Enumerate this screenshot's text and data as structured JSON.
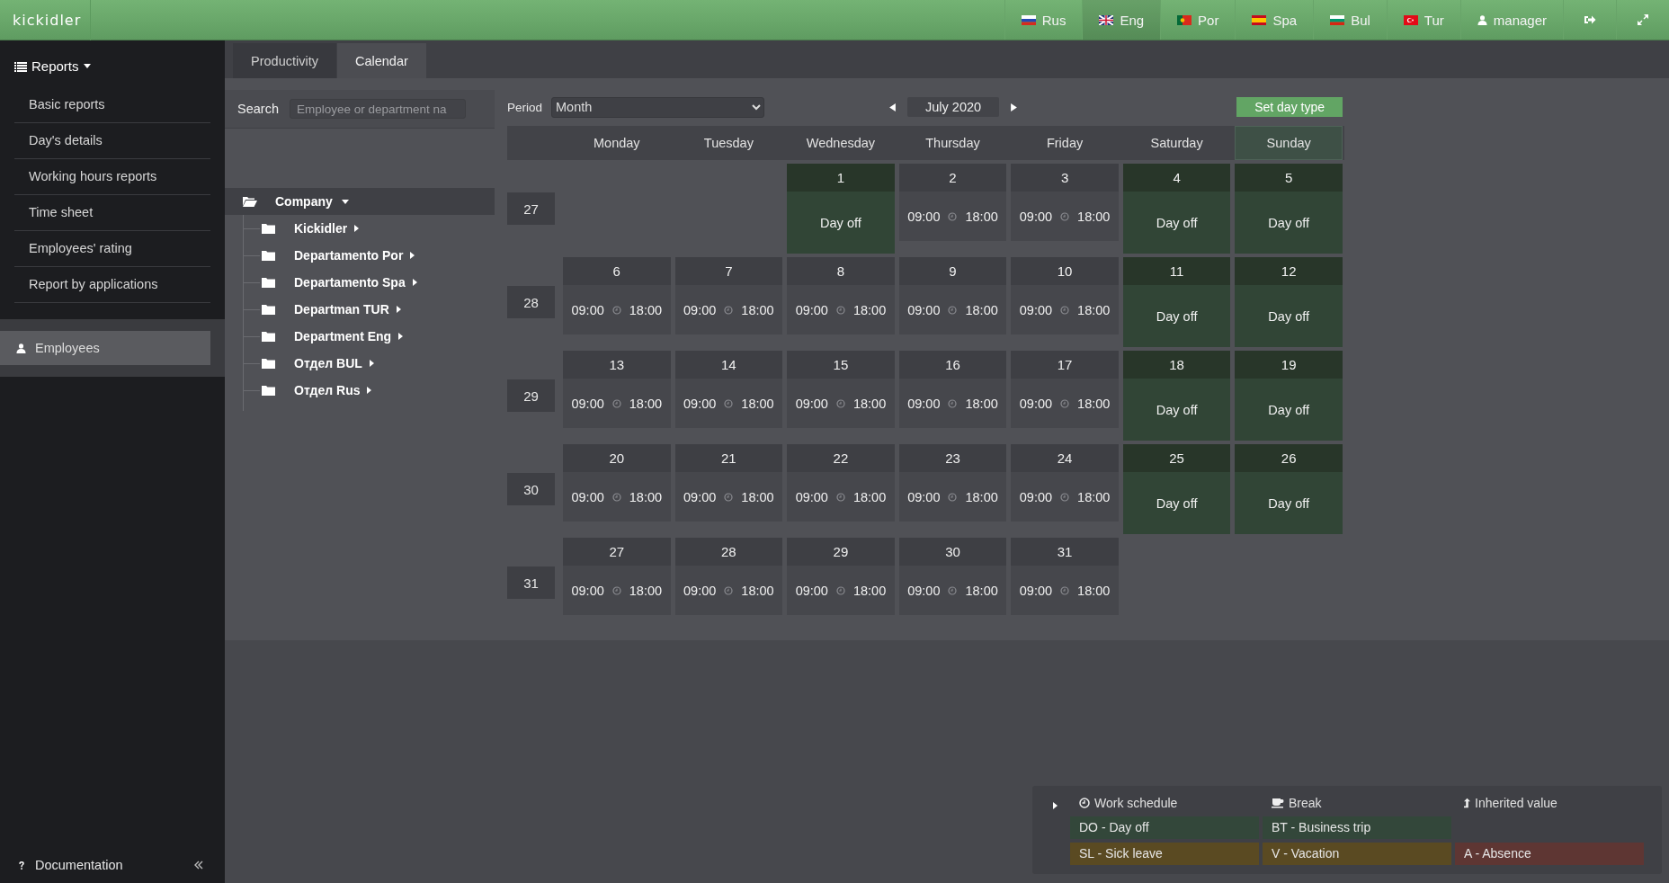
{
  "topbar": {
    "logo": "kickidler",
    "languages": [
      {
        "label": "Rus",
        "selected": false
      },
      {
        "label": "Eng",
        "selected": true
      },
      {
        "label": "Por",
        "selected": false
      },
      {
        "label": "Spa",
        "selected": false
      },
      {
        "label": "Bul",
        "selected": false
      },
      {
        "label": "Tur",
        "selected": false
      }
    ],
    "user": "manager"
  },
  "sidebar": {
    "section": "Reports",
    "items": [
      {
        "label": "Basic reports"
      },
      {
        "label": "Day's details"
      },
      {
        "label": "Working hours reports"
      },
      {
        "label": "Time sheet"
      },
      {
        "label": "Employees' rating"
      },
      {
        "label": "Report by applications"
      }
    ],
    "employees": {
      "label": "Employees",
      "selected": true
    },
    "documentation": "Documentation"
  },
  "tabs": [
    {
      "label": "Productivity",
      "selected": false
    },
    {
      "label": "Calendar",
      "selected": true
    }
  ],
  "search": {
    "label": "Search",
    "placeholder": "Employee or department na"
  },
  "tree": {
    "label": "Company",
    "expanded": true,
    "children": [
      {
        "label": "Kickidler",
        "expanded": false
      },
      {
        "label": "Departamento Por",
        "expanded": false
      },
      {
        "label": "Departamento Spa",
        "expanded": false
      },
      {
        "label": "Departman TUR",
        "expanded": false
      },
      {
        "label": "Department Eng",
        "expanded": false
      },
      {
        "label": "Отдел BUL",
        "expanded": false
      },
      {
        "label": "Отдел Rus",
        "expanded": false
      }
    ]
  },
  "calendar": {
    "period_label": "Period",
    "period": "Month",
    "month": "July 2020",
    "set_day_type": "Set day type",
    "weekdays": [
      {
        "label": "Monday",
        "selected": false
      },
      {
        "label": "Tuesday",
        "selected": false
      },
      {
        "label": "Wednesday",
        "selected": false
      },
      {
        "label": "Thursday",
        "selected": false
      },
      {
        "label": "Friday",
        "selected": false
      },
      {
        "label": "Saturday",
        "selected": false
      },
      {
        "label": "Sunday",
        "selected": true
      }
    ],
    "weeks": [
      {
        "number": "27",
        "days": [
          {
            "kind": "blank"
          },
          {
            "kind": "blank"
          },
          {
            "kind": "off",
            "date": "1",
            "label": "Day off"
          },
          {
            "kind": "work",
            "date": "2",
            "start": "09:00",
            "end": "18:00"
          },
          {
            "kind": "work",
            "date": "3",
            "start": "09:00",
            "end": "18:00"
          },
          {
            "kind": "off",
            "date": "4",
            "label": "Day off"
          },
          {
            "kind": "off",
            "date": "5",
            "label": "Day off"
          }
        ]
      },
      {
        "number": "28",
        "days": [
          {
            "kind": "work",
            "date": "6",
            "start": "09:00",
            "end": "18:00"
          },
          {
            "kind": "work",
            "date": "7",
            "start": "09:00",
            "end": "18:00"
          },
          {
            "kind": "work",
            "date": "8",
            "start": "09:00",
            "end": "18:00"
          },
          {
            "kind": "work",
            "date": "9",
            "start": "09:00",
            "end": "18:00"
          },
          {
            "kind": "work",
            "date": "10",
            "start": "09:00",
            "end": "18:00"
          },
          {
            "kind": "off",
            "date": "11",
            "label": "Day off"
          },
          {
            "kind": "off",
            "date": "12",
            "label": "Day off"
          }
        ]
      },
      {
        "number": "29",
        "days": [
          {
            "kind": "work",
            "date": "13",
            "start": "09:00",
            "end": "18:00"
          },
          {
            "kind": "work",
            "date": "14",
            "start": "09:00",
            "end": "18:00"
          },
          {
            "kind": "work",
            "date": "15",
            "start": "09:00",
            "end": "18:00"
          },
          {
            "kind": "work",
            "date": "16",
            "start": "09:00",
            "end": "18:00"
          },
          {
            "kind": "work",
            "date": "17",
            "start": "09:00",
            "end": "18:00"
          },
          {
            "kind": "off",
            "date": "18",
            "label": "Day off"
          },
          {
            "kind": "off",
            "date": "19",
            "label": "Day off"
          }
        ]
      },
      {
        "number": "30",
        "days": [
          {
            "kind": "work",
            "date": "20",
            "start": "09:00",
            "end": "18:00"
          },
          {
            "kind": "work",
            "date": "21",
            "start": "09:00",
            "end": "18:00"
          },
          {
            "kind": "work",
            "date": "22",
            "start": "09:00",
            "end": "18:00"
          },
          {
            "kind": "work",
            "date": "23",
            "start": "09:00",
            "end": "18:00"
          },
          {
            "kind": "work",
            "date": "24",
            "start": "09:00",
            "end": "18:00"
          },
          {
            "kind": "off",
            "date": "25",
            "label": "Day off"
          },
          {
            "kind": "off",
            "date": "26",
            "label": "Day off"
          }
        ]
      },
      {
        "number": "31",
        "days": [
          {
            "kind": "work",
            "date": "27",
            "start": "09:00",
            "end": "18:00"
          },
          {
            "kind": "work",
            "date": "28",
            "start": "09:00",
            "end": "18:00"
          },
          {
            "kind": "work",
            "date": "29",
            "start": "09:00",
            "end": "18:00"
          },
          {
            "kind": "work",
            "date": "30",
            "start": "09:00",
            "end": "18:00"
          },
          {
            "kind": "work",
            "date": "31",
            "start": "09:00",
            "end": "18:00"
          },
          {
            "kind": "blank"
          },
          {
            "kind": "blank"
          }
        ]
      }
    ]
  },
  "legend": {
    "headings": [
      {
        "label": "Work schedule"
      },
      {
        "label": "Break"
      },
      {
        "label": "Inherited value"
      }
    ],
    "rows": [
      [
        {
          "label": "DO - Day off",
          "color": "#33473a"
        },
        {
          "label": "BT - Business trip",
          "color": "#33473a"
        }
      ],
      [
        {
          "label": "SL - Sick leave",
          "color": "#5a4a22"
        },
        {
          "label": "V - Vacation",
          "color": "#5a4a22"
        },
        {
          "label": "A - Absence",
          "color": "#5e3633"
        }
      ]
    ]
  }
}
